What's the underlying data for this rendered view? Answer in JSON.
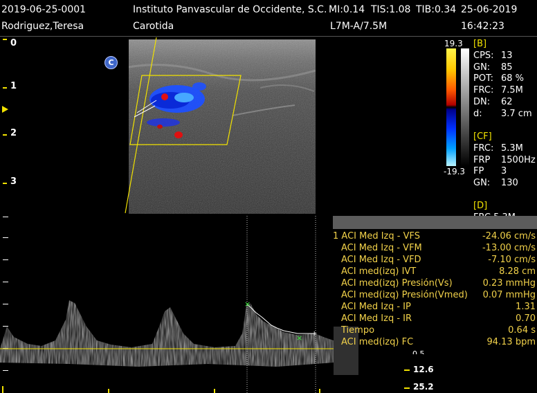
{
  "header": {
    "patient_id": "2019-06-25-0001",
    "institution": "Instituto Panvascular de Occidente, S.C.",
    "mi": "MI:0.14",
    "tis": "TIS:1.08",
    "tib": "TIB:0.34",
    "date": "25-06-2019",
    "patient_name": "Rodriguez,Teresa",
    "exam": "Carotida",
    "probe": "L7M-A/7.5M",
    "time": "16:42:23"
  },
  "depth_ruler": {
    "labels": [
      "0",
      "1",
      "2",
      "3"
    ]
  },
  "image_marker": "C",
  "color_scale": {
    "top": "19.3",
    "bottom": "-19.3"
  },
  "params_b": {
    "title": "[B]",
    "rows": [
      {
        "k": "CPS:",
        "v": "13"
      },
      {
        "k": "GN:",
        "v": "85"
      },
      {
        "k": "POT:",
        "v": "68 %"
      },
      {
        "k": "FRC:",
        "v": "7.5M"
      },
      {
        "k": "DN:",
        "v": "62"
      },
      {
        "k": "d:",
        "v": "3.7 cm"
      }
    ]
  },
  "params_cf": {
    "title": "[CF]",
    "rows": [
      {
        "k": "FRC:",
        "v": "5.3M"
      },
      {
        "k": "FRP",
        "v": "1500Hz"
      },
      {
        "k": "FP",
        "v": "3"
      },
      {
        "k": "GN:",
        "v": "130"
      }
    ]
  },
  "params_d": {
    "title": "[D]",
    "partial": "FRC  5.3M"
  },
  "measurements": [
    {
      "label": "1 ACI Med Izq - VFS",
      "value": "-24.06 cm/s"
    },
    {
      "label": "ACI Med Izq - VFM",
      "value": "-13.00 cm/s"
    },
    {
      "label": "ACI Med Izq - VFD",
      "value": "-7.10 cm/s"
    },
    {
      "label": "ACI med(izq) IVT",
      "value": "8.28 cm"
    },
    {
      "label": "ACI med(izq) Presión(Vs)",
      "value": "0.23 mmHg"
    },
    {
      "label": "ACI med(izq) Presión(Vmed)",
      "value": "0.07 mmHg"
    },
    {
      "label": "ACI Med Izq - IP",
      "value": "1.31"
    },
    {
      "label": "ACI Med Izq - IR",
      "value": "0.70"
    },
    {
      "label": "Tiempo",
      "value": "0.64 s"
    },
    {
      "label": "ACI med(izq) FC",
      "value": "94.13 bpm"
    }
  ],
  "doppler_scale": {
    "labels": [
      "12.6",
      "25.2"
    ],
    "partial": "0.5"
  },
  "colors": {
    "accent_yellow": "#f2e200",
    "measure_text": "#f2d24a",
    "flow_blue": "#1e50ff",
    "flow_red": "#e01010"
  }
}
